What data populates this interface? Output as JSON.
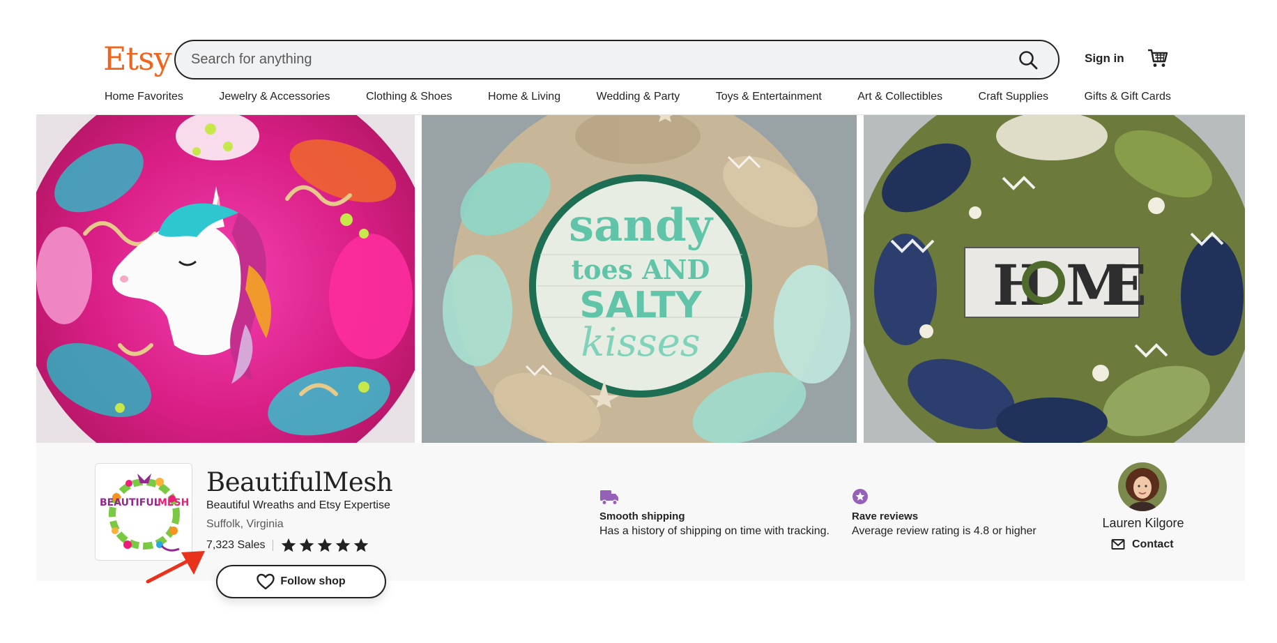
{
  "header": {
    "logo": "Etsy",
    "search_placeholder": "Search for anything",
    "signin_label": "Sign in"
  },
  "nav": {
    "items": [
      "Home Favorites",
      "Jewelry & Accessories",
      "Clothing & Shoes",
      "Home & Living",
      "Wedding & Party",
      "Toys & Entertainment",
      "Art & Collectibles",
      "Craft Supplies",
      "Gifts & Gift Cards"
    ]
  },
  "banner": {
    "wreath_2_sign": [
      "sandy",
      "toes AND",
      "SALTY",
      "kisses"
    ],
    "wreath_3_sign": [
      "H",
      "M",
      "E"
    ]
  },
  "shop": {
    "logo_text_left": "BEAUTIFUL",
    "logo_text_right": "MESH",
    "name": "BeautifulMesh",
    "tagline": "Beautiful Wreaths and Etsy Expertise",
    "location": "Suffolk, Virginia",
    "sales": "7,323 Sales",
    "rating_stars": 5,
    "follow_label": "Follow shop"
  },
  "features": {
    "shipping": {
      "title": "Smooth shipping",
      "desc": "Has a history of shipping on time with tracking."
    },
    "reviews": {
      "title": "Rave reviews",
      "desc": "Average review rating is 4.8 or higher"
    }
  },
  "owner": {
    "name": "Lauren Kilgore",
    "contact_label": "Contact"
  },
  "colors": {
    "brand": "#F1641E",
    "feature_icon": "#9560B8",
    "annotation_arrow": "#E8321C"
  }
}
